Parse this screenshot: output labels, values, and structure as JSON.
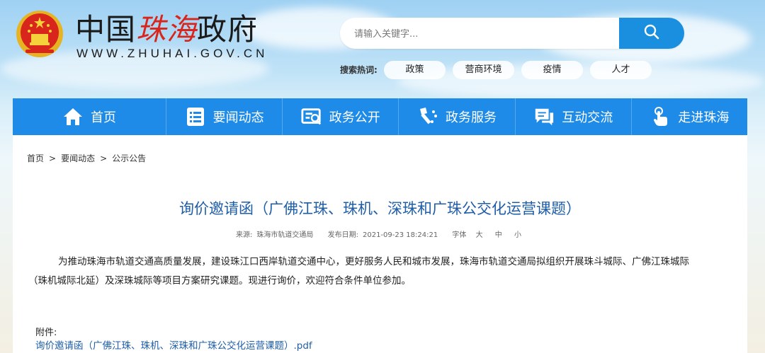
{
  "header": {
    "site_name_a": "中国",
    "site_name_b": "珠海",
    "site_name_c": "政府",
    "site_url": "WWW.ZHUHAI.GOV.CN"
  },
  "search": {
    "placeholder": "请输入关键字..."
  },
  "hot_search": {
    "label": "搜索热词:",
    "tags": [
      "政策",
      "营商环境",
      "疫情",
      "人才"
    ]
  },
  "nav": {
    "items": [
      {
        "label": "首页",
        "icon": "home-icon"
      },
      {
        "label": "要闻动态",
        "icon": "news-list-icon"
      },
      {
        "label": "政务公开",
        "icon": "document-search-icon"
      },
      {
        "label": "政务服务",
        "icon": "service-icon"
      },
      {
        "label": "互动交流",
        "icon": "chat-icon"
      },
      {
        "label": "走进珠海",
        "icon": "hand-pointer-icon"
      }
    ]
  },
  "breadcrumb": [
    "首页",
    "要闻动态",
    "公示公告"
  ],
  "breadcrumb_sep": ">",
  "article": {
    "title": "询价邀请函（广佛江珠、珠机、深珠和广珠公交化运营课题）",
    "source_label": "来源:",
    "source": "珠海市轨道交通局",
    "date_label": "发布日期:",
    "date": "2021-09-23 18:24:21",
    "font_label": "字体",
    "font_sizes": [
      "大",
      "中",
      "小"
    ],
    "body_line1": "为推动珠海市轨道交通高质量发展，建设珠江口西岸轨道交通中心，更好服务人民和城市发展，珠海市轨道交通局拟组织开展珠斗城际、广佛江珠城际",
    "body_line2": "（珠机城际北延）及深珠城际等项目方案研究课题。现进行询价，欢迎符合条件单位参加。",
    "attachment_label": "附件:",
    "attachment_name": "询价邀请函（广佛江珠、珠机、深珠和广珠公交化运营课题）.pdf"
  },
  "colors": {
    "nav_bg": "#1f8be8",
    "title": "#1e5ea8",
    "search_button": "#1a8fdf",
    "brand_red": "#d9261c"
  }
}
